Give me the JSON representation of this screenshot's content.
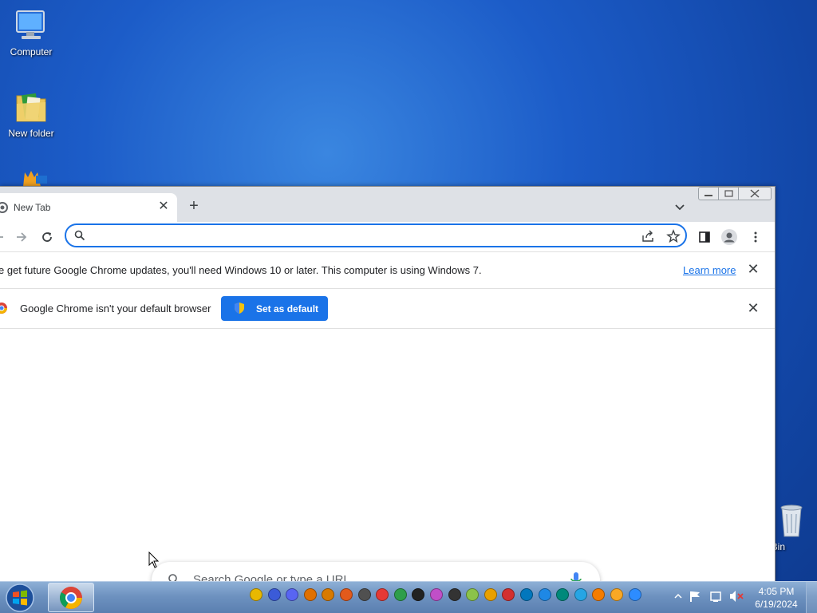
{
  "desktop": {
    "icons": [
      {
        "label": "Computer"
      },
      {
        "label": "New folder"
      },
      {
        "label": ""
      },
      {
        "label": "cle Bin"
      }
    ]
  },
  "browser": {
    "tab": {
      "title": "New Tab",
      "close_symbol": "✕"
    },
    "new_tab_symbol": "+",
    "omnibox": {
      "value": "",
      "placeholder": ""
    },
    "infobars": [
      {
        "message": "e get future Google Chrome updates, you'll need Windows 10 or later. This computer is using Windows 7.",
        "link": "Learn more",
        "close_symbol": "✕"
      },
      {
        "message": "Google Chrome isn't your default browser",
        "button": "Set as default",
        "close_symbol": "✕"
      }
    ],
    "ntp_search": {
      "placeholder": "Search Google or type a URL"
    }
  },
  "taskbar": {
    "clock": {
      "time": "4:05 PM",
      "date": "6/19/2024"
    },
    "tray_colors": [
      "#e8b800",
      "#3b5bd8",
      "#5865f2",
      "#e07000",
      "#d87a00",
      "#e25a1c",
      "#505050",
      "#e53935",
      "#2e9e4a",
      "#222222",
      "#c04fc8",
      "#333333",
      "#8bc34a",
      "#e8a000",
      "#d32f2f",
      "#0277bd",
      "#1e88e5",
      "#00897b",
      "#26a5e4",
      "#f57c00",
      "#f9a825",
      "#2d8cff"
    ]
  },
  "colors": {
    "accent": "#1a73e8",
    "tabstrip": "#dee1e6"
  }
}
